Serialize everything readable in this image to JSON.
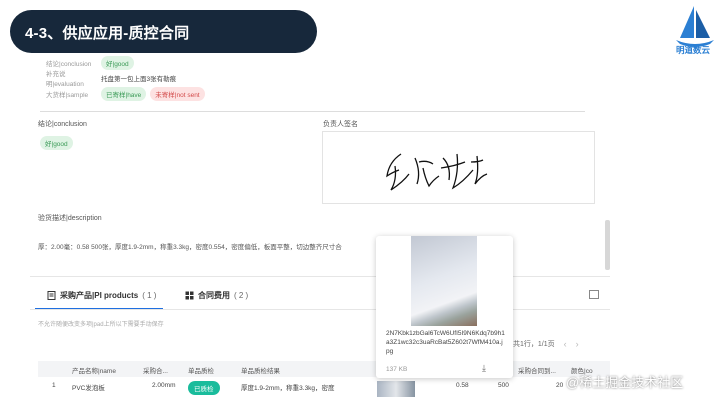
{
  "slide": {
    "title": "4-3、供应应用-质控合同"
  },
  "logo": {
    "text": "明道数云",
    "color": "#2b7fd3",
    "icon": "sailboat-icon"
  },
  "top_card": {
    "rows": [
      {
        "label": "结论|conclusion",
        "tags": [
          {
            "text": "好|good",
            "tone": "green"
          }
        ]
      },
      {
        "label": "补充说明|evaluation",
        "text": "托盘第一包上面3张有勒痕"
      },
      {
        "label": "大货样|sample",
        "tags": [
          {
            "text": "已寄样|have",
            "tone": "green"
          },
          {
            "text": "未寄样|not sent",
            "tone": "red"
          }
        ]
      }
    ]
  },
  "conclusion": {
    "label": "结论|conclusion",
    "tag": "好|good"
  },
  "signature": {
    "label": "负责人签名",
    "alt": "手写签名"
  },
  "description": {
    "label": "验货描述|description",
    "text": "厚：2.00毫：0.58 500张，厚度1.9-2mm，称重3.3kg，密度0.554，密度偏低，板面平整，切边整齐尺寸合"
  },
  "tabs": [
    {
      "label": "采购产品|PI products",
      "count": "( 1 )",
      "active": true,
      "icon": "document-icon"
    },
    {
      "label": "合同费用",
      "count": "( 2 )",
      "active": false,
      "icon": "table-icon"
    }
  ],
  "hint": "不允许随便改变多项|pad上所以下需要手动保存",
  "pager": {
    "summary": "共1行，1/1页",
    "prev": "‹",
    "next": "›"
  },
  "table": {
    "headers": [
      "",
      "产品名称|name",
      "采购合...",
      "单品质检",
      "单品质检结果",
      "",
      "",
      "采购合同到...",
      "颜色|co"
    ],
    "rows": [
      {
        "index": "1",
        "name": "PVC发泡板",
        "spec": "2.00mm",
        "qc": "已质检",
        "result": "厚度1.9-2mm，称重3.3kg，密度",
        "price": "0.58",
        "qty": "500",
        "date": "20",
        "color": ""
      }
    ]
  },
  "attachment": {
    "filename": "2N7Kbk1zbGal6TcW6UfI5I9N6Kdq7b9h1a3Z1wc32c3uaRcBat5Z602t7WfM410a.jpg",
    "size": "137 KB"
  },
  "watermark": "@稀土掘金技术社区"
}
